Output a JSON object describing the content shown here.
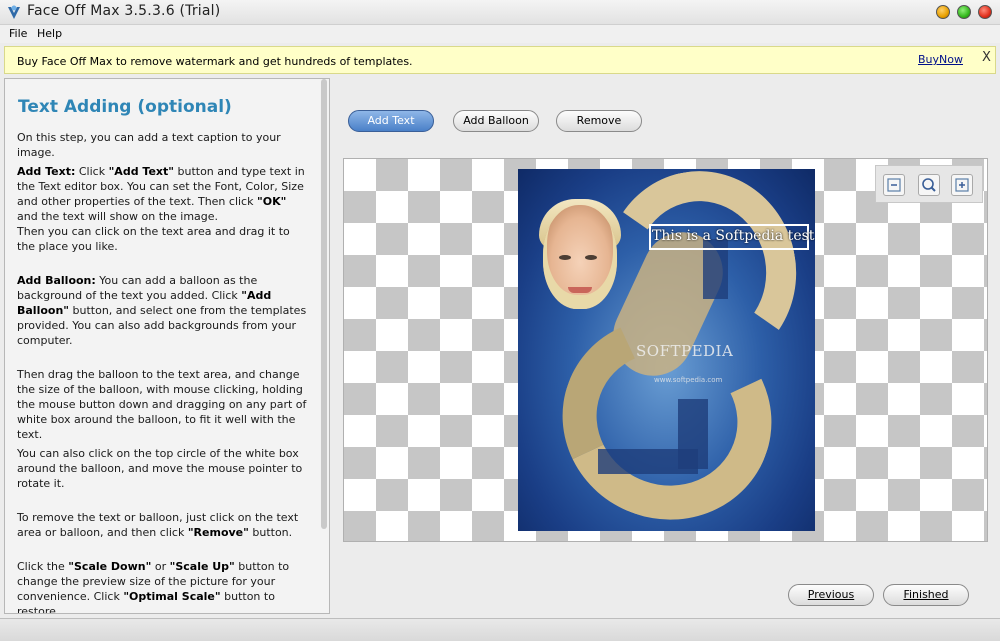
{
  "window": {
    "title": "Face Off Max  3.5.3.6  (Trial)"
  },
  "menu": {
    "items": [
      "File",
      "Help"
    ]
  },
  "banner": {
    "text": "Buy Face Off Max to remove watermark and get hundreds of templates.",
    "link": "BuyNow",
    "close": "X"
  },
  "panel": {
    "heading": "Text Adding (optional)",
    "p1": "On this step, you can add a text caption to your image.",
    "p2_bold1": "Add Text:",
    "p2_a": " Click ",
    "p2_bold2": "\"Add Text\"",
    "p2_b": " button and type text in the Text editor box. You can set the Font, Color, Size and other properties of the text. Then click ",
    "p2_bold3": "\"OK\"",
    "p2_c": " and the text will show on the image.",
    "p2_d": "Then you can click on the text area and drag it to the place you like.",
    "p3_bold1": "Add Balloon:",
    "p3_a": " You can add a balloon as the background of the text you added. Click ",
    "p3_bold2": "\"Add Balloon\"",
    "p3_b": " button, and select one from the templates provided. You can also add backgrounds from your computer.",
    "p4": "Then drag the balloon to the text area, and change the size of the balloon, with mouse clicking, holding the mouse button down and dragging on any part of white box around the balloon, to fit it well with the text.",
    "p5": "You can also click on the top circle of the white box around the balloon, and move the mouse pointer to rotate it.",
    "p6_a": "To remove the text or balloon, just click on the text area or balloon, and then click ",
    "p6_bold": "\"Remove\"",
    "p6_b": " button.",
    "p7_a": "Click the ",
    "p7_bold1": "\"Scale Down\"",
    "p7_b": " or ",
    "p7_bold2": "\"Scale Up\"",
    "p7_c": " button to change the preview size of the picture for your convenience. Click ",
    "p7_bold3": "\"Optimal Scale\"",
    "p7_d": " button to restore."
  },
  "toolbar": {
    "add_text": "Add Text",
    "add_balloon": "Add Balloon",
    "remove": "Remove"
  },
  "canvas": {
    "caption": "This is a Softpedia test",
    "watermark": "SOFTPEDIA",
    "watermark_url": "www.softpedia.com",
    "zoom_icons": [
      "scale-down-icon",
      "optimal-scale-icon",
      "scale-up-icon"
    ]
  },
  "nav": {
    "previous": "Previous",
    "finished": "Finished"
  },
  "colors": {
    "heading": "#2f86b6",
    "banner_bg": "#ffffc8",
    "primary_button": "#4a80c8"
  }
}
